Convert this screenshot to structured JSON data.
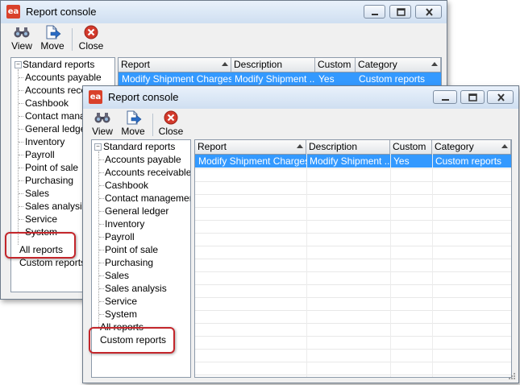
{
  "window_title": "Report console",
  "app_icon_text": "ea",
  "toolbar": {
    "view_label": "View",
    "move_label": "Move",
    "close_label": "Close"
  },
  "tree": {
    "root_label": "Standard reports",
    "children": [
      "Accounts payable",
      "Accounts receivable",
      "Cashbook",
      "Contact management",
      "General ledger",
      "Inventory",
      "Payroll",
      "Point of sale",
      "Purchasing",
      "Sales",
      "Sales analysis",
      "Service",
      "System"
    ],
    "all_reports_label": "All reports",
    "custom_reports_label": "Custom reports",
    "back_children": [
      "Accounts payable",
      "Accounts receiva",
      "Cashbook",
      "Contact manag",
      "General ledger",
      "Inventory",
      "Payroll",
      "Point of sale",
      "Purchasing",
      "Sales",
      "Sales analysis",
      "Service",
      "System"
    ]
  },
  "grid": {
    "columns": [
      "Report",
      "Description",
      "Custom",
      "Category"
    ],
    "rows": [
      {
        "report": "Modify Shipment Charges",
        "description": "Modify Shipment ...",
        "custom": "Yes",
        "category": "Custom reports"
      }
    ]
  },
  "colors": {
    "selection": "#3399ff",
    "callout": "#c3262b",
    "titlebar": "#cfdff1"
  }
}
